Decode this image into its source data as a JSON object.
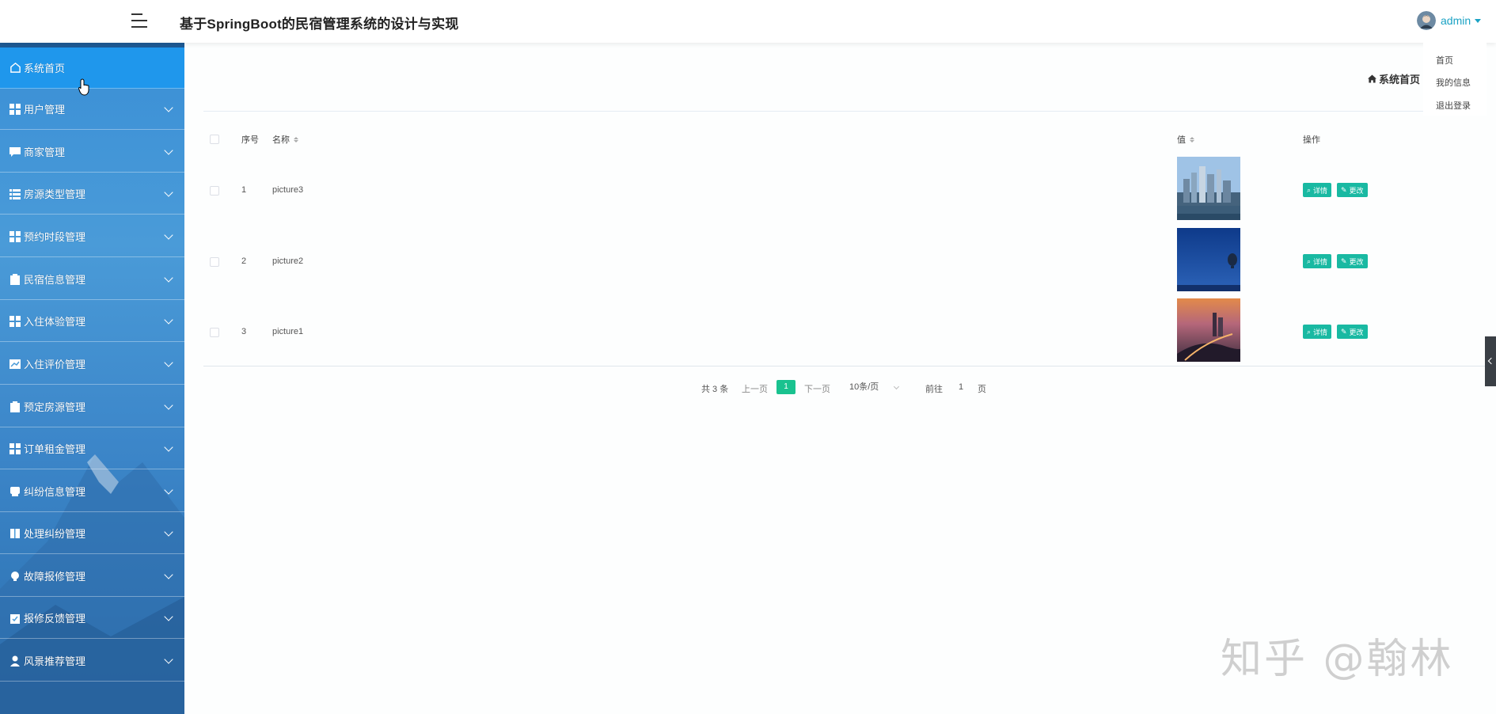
{
  "header": {
    "title": "基于SpringBoot的民宿管理系统的设计与实现",
    "user_name": "admin"
  },
  "user_menu": {
    "items": [
      "首页",
      "我的信息",
      "退出登录"
    ]
  },
  "sidebar": {
    "items": [
      {
        "label": "系统首页",
        "icon": "home-icon",
        "active": true
      },
      {
        "label": "用户管理",
        "icon": "grid-icon"
      },
      {
        "label": "商家管理",
        "icon": "chat-icon"
      },
      {
        "label": "房源类型管理",
        "icon": "list-icon"
      },
      {
        "label": "预约时段管理",
        "icon": "grid-icon"
      },
      {
        "label": "民宿信息管理",
        "icon": "clipboard-icon"
      },
      {
        "label": "入住体验管理",
        "icon": "grid-icon"
      },
      {
        "label": "入住评价管理",
        "icon": "chart-icon"
      },
      {
        "label": "预定房源管理",
        "icon": "clipboard-icon"
      },
      {
        "label": "订单租金管理",
        "icon": "grid-icon"
      },
      {
        "label": "纠纷信息管理",
        "icon": "message-icon"
      },
      {
        "label": "处理纠纷管理",
        "icon": "book-icon"
      },
      {
        "label": "故障报修管理",
        "icon": "bulb-icon"
      },
      {
        "label": "报修反馈管理",
        "icon": "clipboard-check-icon"
      },
      {
        "label": "风景推荐管理",
        "icon": "user-icon"
      }
    ]
  },
  "breadcrumb": {
    "label": "系统首页"
  },
  "table": {
    "headers": {
      "index": "序号",
      "name": "名称",
      "value": "值",
      "actions": "操作"
    },
    "rows": [
      {
        "index": "1",
        "name": "picture3",
        "image": "city-skyline"
      },
      {
        "index": "2",
        "name": "picture2",
        "image": "night-sky-balloon"
      },
      {
        "index": "3",
        "name": "picture1",
        "image": "river-sunset"
      }
    ],
    "detail_label": "详情",
    "edit_label": "更改"
  },
  "pagination": {
    "total": "共 3 条",
    "prev": "上一页",
    "current": "1",
    "next": "下一页",
    "page_size": "10条/页",
    "goto_prefix": "前往",
    "goto_value": "1",
    "goto_suffix": "页"
  },
  "watermark": "知乎 @翰林",
  "colors": {
    "accent": "#19b9a2",
    "sidebar": "#3a8fd6",
    "active": "#1f97ec",
    "user": "#1aa2c4"
  }
}
